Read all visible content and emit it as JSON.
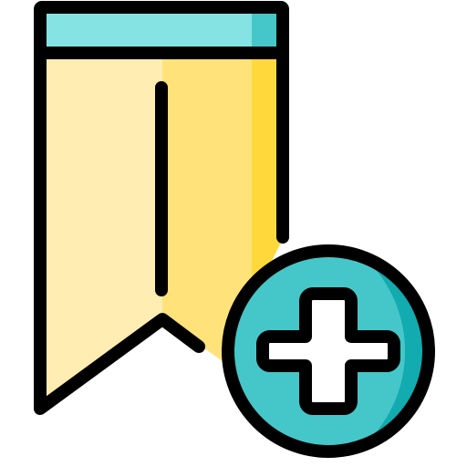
{
  "icon": {
    "name": "add-bookmark-icon",
    "parts": [
      "bookmark-icon",
      "plus-circle-icon"
    ]
  },
  "colors": {
    "outline": "#000000",
    "bookmark_light": "#FFEDB1",
    "bookmark_mid": "#FFE27A",
    "bookmark_dark": "#FFD93B",
    "cap_light": "#86E3E3",
    "cap_dark": "#45C7C9",
    "circle_fill": "#45C7C9",
    "circle_shade": "#12ABAF",
    "plus_fill": "#ffffff"
  }
}
